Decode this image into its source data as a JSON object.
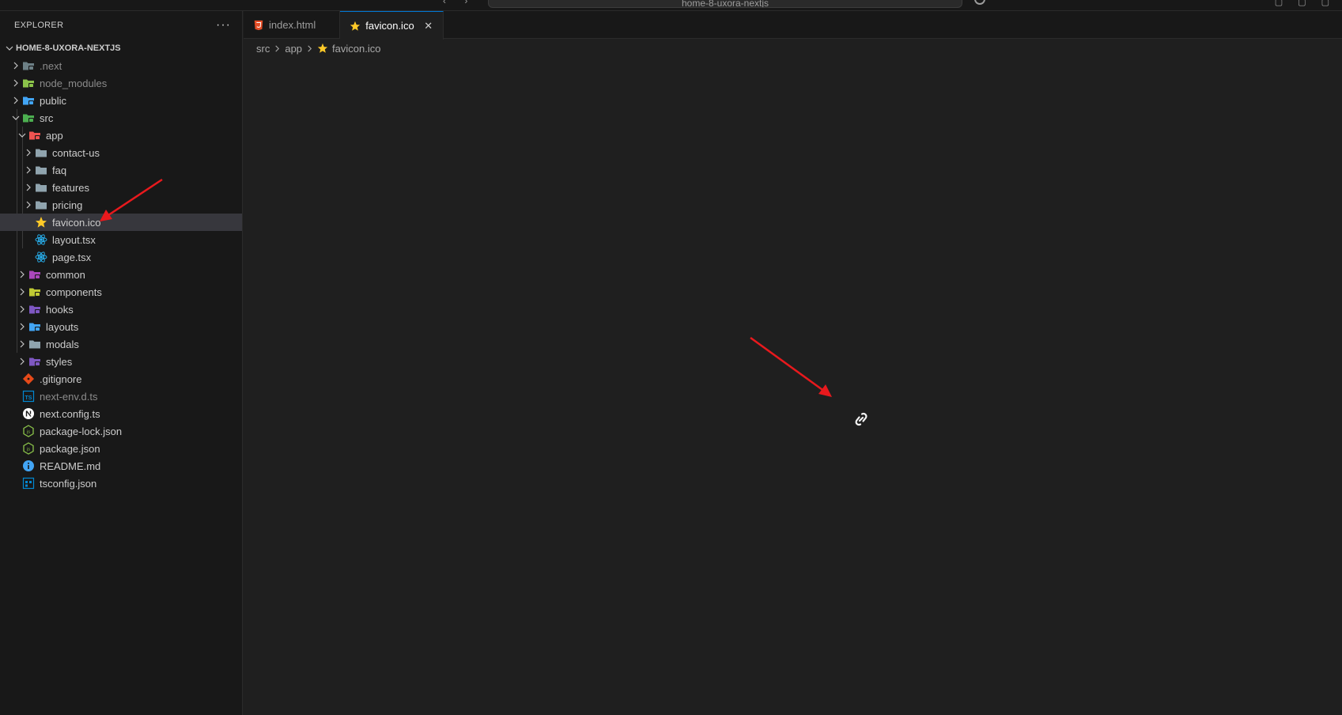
{
  "titlebar": {
    "search_text": "home-8-uxora-nextjs",
    "nav": "‹ ›",
    "controls": "▢ ▢ ▢"
  },
  "sidebar": {
    "title": "EXPLORER",
    "more": "···",
    "root": "HOME-8-UXORA-NEXTJS",
    "items": [
      {
        "label": ".next",
        "depth": 1,
        "kind": "folder",
        "expanded": false,
        "dim": true,
        "icon": "next-folder-icon",
        "color": "#6d8086"
      },
      {
        "label": "node_modules",
        "depth": 1,
        "kind": "folder",
        "expanded": false,
        "dim": true,
        "icon": "node-folder-icon",
        "color": "#8bc34a"
      },
      {
        "label": "public",
        "depth": 1,
        "kind": "folder",
        "expanded": false,
        "icon": "public-folder-icon",
        "color": "#42a5f5"
      },
      {
        "label": "src",
        "depth": 1,
        "kind": "folder",
        "expanded": true,
        "icon": "src-folder-icon",
        "color": "#4caf50"
      },
      {
        "label": "app",
        "depth": 2,
        "kind": "folder",
        "expanded": true,
        "icon": "app-folder-icon",
        "color": "#ef5350"
      },
      {
        "label": "contact-us",
        "depth": 3,
        "kind": "folder",
        "expanded": false,
        "icon": "folder-icon",
        "color": "#90a4ae"
      },
      {
        "label": "faq",
        "depth": 3,
        "kind": "folder",
        "expanded": false,
        "icon": "folder-icon",
        "color": "#90a4ae"
      },
      {
        "label": "features",
        "depth": 3,
        "kind": "folder",
        "expanded": false,
        "icon": "folder-icon",
        "color": "#90a4ae"
      },
      {
        "label": "pricing",
        "depth": 3,
        "kind": "folder",
        "expanded": false,
        "icon": "folder-icon",
        "color": "#90a4ae"
      },
      {
        "label": "favicon.ico",
        "depth": 3,
        "kind": "file",
        "selected": true,
        "icon": "star-icon",
        "color": "#ffca28"
      },
      {
        "label": "layout.tsx",
        "depth": 3,
        "kind": "file",
        "icon": "react-icon",
        "color": "#29b6f6"
      },
      {
        "label": "page.tsx",
        "depth": 3,
        "kind": "file",
        "icon": "react-icon",
        "color": "#29b6f6"
      },
      {
        "label": "common",
        "depth": 2,
        "kind": "folder",
        "expanded": false,
        "icon": "common-folder-icon",
        "color": "#ab47bc"
      },
      {
        "label": "components",
        "depth": 2,
        "kind": "folder",
        "expanded": false,
        "icon": "components-folder-icon",
        "color": "#c0ca33"
      },
      {
        "label": "hooks",
        "depth": 2,
        "kind": "folder",
        "expanded": false,
        "icon": "hooks-folder-icon",
        "color": "#7e57c2"
      },
      {
        "label": "layouts",
        "depth": 2,
        "kind": "folder",
        "expanded": false,
        "icon": "layouts-folder-icon",
        "color": "#42a5f5"
      },
      {
        "label": "modals",
        "depth": 2,
        "kind": "folder",
        "expanded": false,
        "icon": "folder-icon",
        "color": "#90a4ae"
      },
      {
        "label": "styles",
        "depth": 2,
        "kind": "folder",
        "expanded": false,
        "icon": "styles-folder-icon",
        "color": "#7e57c2"
      },
      {
        "label": ".gitignore",
        "depth": 1,
        "kind": "file",
        "icon": "git-icon",
        "color": "#e64a19"
      },
      {
        "label": "next-env.d.ts",
        "depth": 1,
        "kind": "file",
        "dim": true,
        "icon": "ts-icon",
        "color": "#0288d1"
      },
      {
        "label": "next.config.ts",
        "depth": 1,
        "kind": "file",
        "icon": "next-icon",
        "color": "#ffffff"
      },
      {
        "label": "package-lock.json",
        "depth": 1,
        "kind": "file",
        "icon": "nodejs-icon",
        "color": "#8bc34a"
      },
      {
        "label": "package.json",
        "depth": 1,
        "kind": "file",
        "icon": "nodejs-icon",
        "color": "#8bc34a"
      },
      {
        "label": "README.md",
        "depth": 1,
        "kind": "file",
        "icon": "info-icon",
        "color": "#42a5f5"
      },
      {
        "label": "tsconfig.json",
        "depth": 1,
        "kind": "file",
        "icon": "tsconfig-icon",
        "color": "#0288d1"
      }
    ]
  },
  "tabs": [
    {
      "label": "index.html",
      "active": false,
      "icon": "html-icon",
      "color": "#e44d26"
    },
    {
      "label": "favicon.ico",
      "active": true,
      "icon": "star-icon",
      "color": "#ffca28",
      "close": "✕"
    }
  ],
  "breadcrumb": [
    "src",
    "app",
    "favicon.ico"
  ],
  "colors": {
    "accent": "#0078d4",
    "annotation": "#e8191d",
    "selected_row": "#37373d"
  }
}
